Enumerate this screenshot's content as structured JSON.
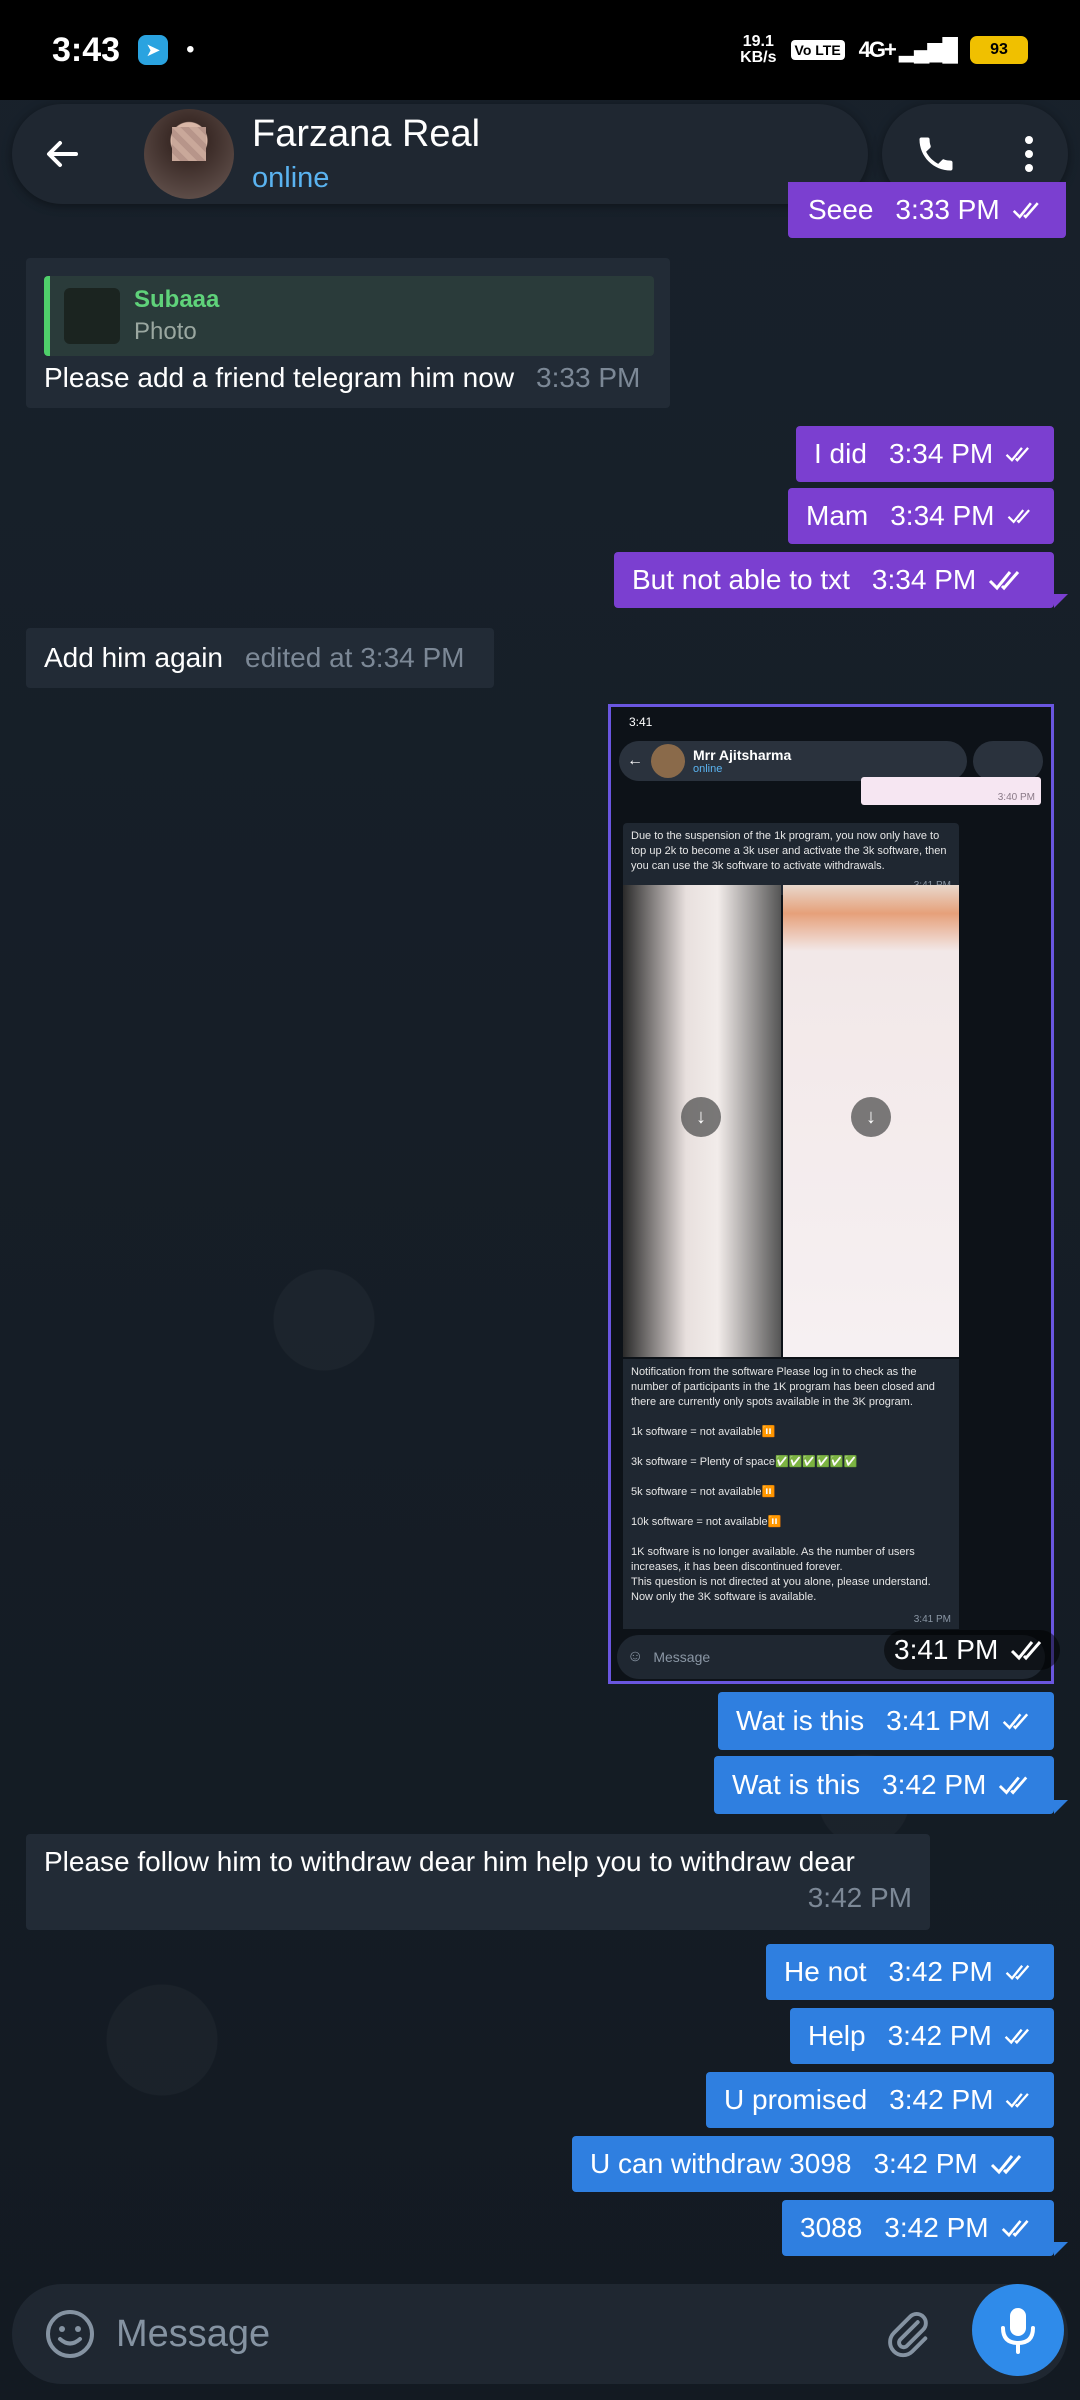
{
  "status_bar": {
    "time": "3:43",
    "dot": "•",
    "net_speed_top": "19.1",
    "net_speed_bottom": "KB/s",
    "volte": "Vo LTE",
    "network": "4G+",
    "battery": "93"
  },
  "header": {
    "contact_name": "Farzana Real",
    "contact_status": "online"
  },
  "messages": [
    {
      "text": "Seee",
      "time": "3:33 PM"
    },
    {
      "reply_name": "Subaaa",
      "reply_type": "Photo",
      "text": "Please add a friend telegram him now",
      "time": "3:33 PM"
    },
    {
      "text": "I did",
      "time": "3:34 PM"
    },
    {
      "text": "Mam",
      "time": "3:34 PM"
    },
    {
      "text": "But not able to txt",
      "time": "3:34 PM"
    },
    {
      "text": "Add him again",
      "time": "edited at 3:34 PM"
    },
    {
      "text": "Wat is this",
      "time": "3:41 PM"
    },
    {
      "text": "Wat is this",
      "time": "3:42 PM"
    },
    {
      "text": "Please follow him to withdraw dear  him help you to withdraw dear",
      "time": "3:42 PM"
    },
    {
      "text": "He not",
      "time": "3:42 PM"
    },
    {
      "text": "Help",
      "time": "3:42 PM"
    },
    {
      "text": "U promised",
      "time": "3:42 PM"
    },
    {
      "text": "U can withdraw 3098",
      "time": "3:42 PM"
    },
    {
      "text": "3088",
      "time": "3:42 PM"
    }
  ],
  "screenshot": {
    "status_time": "3:41",
    "contact_name": "Mrr Ajitsharma",
    "contact_status": "online",
    "pink_time": "3:40 PM",
    "msg1": "Due to the suspension of the 1k program, you now only have to top up 2k to become a 3k user and activate the 3k software, then you can use the 3k software to activate withdrawals.",
    "msg1_time": "3:41 PM",
    "msg2": "Notification from the software Please log in to check as the number of participants in the 1K program has been closed and there are currently only spots available in the 3K program.\n\n1k software = not available⏸️\n\n3k software = Plenty of space✅✅✅✅✅✅\n\n5k software = not available⏸️\n\n10k software = not available⏸️\n\n1K software is no longer available. As the number of users increases, it has been discontinued forever.\nThis question is not directed at you alone, please understand.\nNow only the 3K software is available.",
    "msg2_time": "3:41 PM",
    "input_placeholder": "Message",
    "sent_time": "3:41 PM"
  },
  "input": {
    "placeholder": "Message"
  },
  "colors": {
    "outgoing_purple": "#7b3fd0",
    "outgoing_blue": "#2f7fe0",
    "incoming": "#222b36",
    "accent": "#2f8bea"
  }
}
